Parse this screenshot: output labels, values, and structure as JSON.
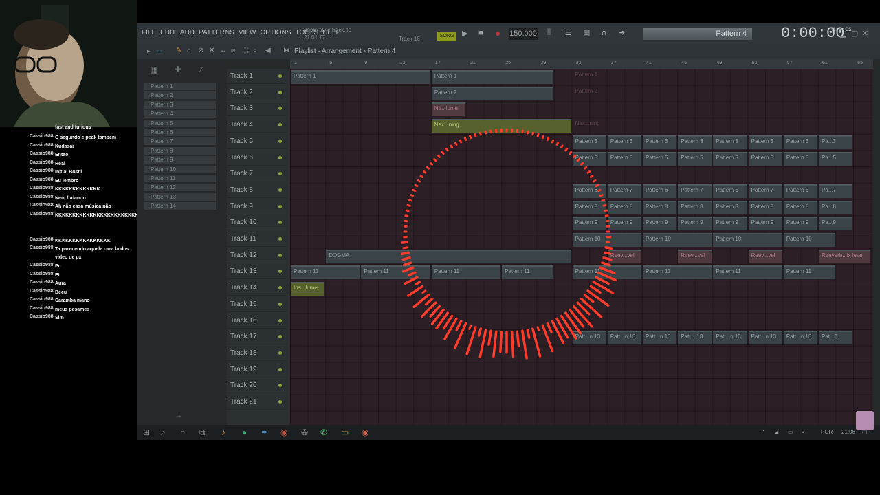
{
  "chat": {
    "first_line": "fast and furious",
    "messages": [
      {
        "user": "Cassio988",
        "text": "O segundo e peak tambem"
      },
      {
        "user": "Cassio988",
        "text": "Kudasai"
      },
      {
        "user": "Cassio988",
        "text": "Entao"
      },
      {
        "user": "Cassio988",
        "text": "Real"
      },
      {
        "user": "Cassio988",
        "text": "Initial Bostil"
      },
      {
        "user": "Cassio988",
        "text": "Eu lembro"
      },
      {
        "user": "Cassio988",
        "text": "KKKKKKKKKKKKK"
      },
      {
        "user": "Cassio988",
        "text": "Nem fudando"
      },
      {
        "user": "Cassio988",
        "text": "Ah não essa música não"
      },
      {
        "user": "Cassio988",
        "text": "KKKKKKKKKKKKKKKKKKKKKKKKKKKKKKKKKKKKKKKKKKKKKKKKKKKLLKKKKKKKKLLL"
      },
      {
        "user": "Cassio988",
        "text": "KKKKKKKKKKKKKKKK"
      },
      {
        "user": "Cassio988",
        "text": "Ta parecendo aquele cara la dos video de px"
      },
      {
        "user": "Cassio988",
        "text": "Pc"
      },
      {
        "user": "Cassio988",
        "text": "Et"
      },
      {
        "user": "Cassio988",
        "text": "Aura"
      },
      {
        "user": "Cassio988",
        "text": "Becu"
      },
      {
        "user": "Cassio988",
        "text": "Caramba mano"
      },
      {
        "user": "Cassio988",
        "text": "meus pesames"
      },
      {
        "user": "Cassio988",
        "text": "Sim"
      }
    ]
  },
  "menu": [
    "FILE",
    "EDIT",
    "ADD",
    "PATTERNS",
    "VIEW",
    "OPTIONS",
    "TOOLS",
    "HELP"
  ],
  "song": {
    "file": "doom style track.flp",
    "time_info": "21:01:77",
    "track_hint": "Track 18"
  },
  "transport": {
    "mode": "SONG",
    "tempo": "150.000",
    "pattern": "Pattern 4",
    "time": "0:00:00",
    "time_unit": "M:S:CS"
  },
  "breadcrumb": "Playlist · Arrangement › Pattern 4",
  "patterns": [
    "Pattern 1",
    "Pattern 2",
    "Pattern 3",
    "Pattern 4",
    "Pattern 5",
    "Pattern 6",
    "Pattern 7",
    "Pattern 8",
    "Pattern 9",
    "Pattern 10",
    "Pattern 11",
    "Pattern 12",
    "Pattern 13",
    "Pattern 14"
  ],
  "ruler": [
    "1",
    "5",
    "9",
    "13",
    "17",
    "21",
    "25",
    "29",
    "33",
    "37",
    "41",
    "45",
    "49",
    "53",
    "57",
    "61",
    "65"
  ],
  "tracks": [
    "Track 1",
    "Track 2",
    "Track 3",
    "Track 4",
    "Track 5",
    "Track 6",
    "Track 7",
    "Track 8",
    "Track 9",
    "Track 10",
    "Track 11",
    "Track 12",
    "Track 13",
    "Track 14",
    "Track 15",
    "Track 16",
    "Track 17",
    "Track 18",
    "Track 19",
    "Track 20",
    "Track 21"
  ],
  "clips": [
    {
      "row": 0,
      "col": 0,
      "len": 8,
      "label": "Pattern 1",
      "kind": "pat"
    },
    {
      "row": 0,
      "col": 8,
      "len": 7,
      "label": "Pattern 1",
      "kind": "pat"
    },
    {
      "row": 0,
      "col": 16,
      "len": 8,
      "label": "Pattern 1",
      "kind": "dim"
    },
    {
      "row": 1,
      "col": 8,
      "len": 7,
      "label": "Pattern 2",
      "kind": "pat"
    },
    {
      "row": 1,
      "col": 16,
      "len": 8,
      "label": "Pattern 2",
      "kind": "dim"
    },
    {
      "row": 2,
      "col": 8,
      "len": 2,
      "label": "Ne...lume",
      "kind": "auto"
    },
    {
      "row": 3,
      "col": 8,
      "len": 8,
      "label": "Nex...ning",
      "kind": "auto-g"
    },
    {
      "row": 3,
      "col": 16,
      "len": 8,
      "label": "Nex...ning",
      "kind": "dim"
    },
    {
      "row": 4,
      "col": 16,
      "len": 2,
      "label": "Pattern 3",
      "kind": "pat"
    },
    {
      "row": 4,
      "col": 18,
      "len": 2,
      "label": "Pattern 3",
      "kind": "pat"
    },
    {
      "row": 4,
      "col": 20,
      "len": 2,
      "label": "Pattern 3",
      "kind": "pat"
    },
    {
      "row": 4,
      "col": 22,
      "len": 2,
      "label": "Pattern 3",
      "kind": "pat"
    },
    {
      "row": 4,
      "col": 24,
      "len": 2,
      "label": "Pattern 3",
      "kind": "pat"
    },
    {
      "row": 4,
      "col": 26,
      "len": 2,
      "label": "Pattern 3",
      "kind": "pat"
    },
    {
      "row": 4,
      "col": 28,
      "len": 2,
      "label": "Pattern 3",
      "kind": "pat"
    },
    {
      "row": 4,
      "col": 30,
      "len": 2,
      "label": "Pa...3",
      "kind": "pat"
    },
    {
      "row": 5,
      "col": 16,
      "len": 2,
      "label": "Pattern 5",
      "kind": "pat"
    },
    {
      "row": 5,
      "col": 18,
      "len": 2,
      "label": "Pattern 5",
      "kind": "pat"
    },
    {
      "row": 5,
      "col": 20,
      "len": 2,
      "label": "Pattern 5",
      "kind": "pat"
    },
    {
      "row": 5,
      "col": 22,
      "len": 2,
      "label": "Pattern 5",
      "kind": "pat"
    },
    {
      "row": 5,
      "col": 24,
      "len": 2,
      "label": "Pattern 5",
      "kind": "pat"
    },
    {
      "row": 5,
      "col": 26,
      "len": 2,
      "label": "Pattern 5",
      "kind": "pat"
    },
    {
      "row": 5,
      "col": 28,
      "len": 2,
      "label": "Pattern 5",
      "kind": "pat"
    },
    {
      "row": 5,
      "col": 30,
      "len": 2,
      "label": "Pa...5",
      "kind": "pat"
    },
    {
      "row": 7,
      "col": 16,
      "len": 2,
      "label": "Pattern 6",
      "kind": "pat"
    },
    {
      "row": 7,
      "col": 18,
      "len": 2,
      "label": "Pattern 7",
      "kind": "pat"
    },
    {
      "row": 7,
      "col": 20,
      "len": 2,
      "label": "Pattern 6",
      "kind": "pat"
    },
    {
      "row": 7,
      "col": 22,
      "len": 2,
      "label": "Pattern 7",
      "kind": "pat"
    },
    {
      "row": 7,
      "col": 24,
      "len": 2,
      "label": "Pattern 6",
      "kind": "pat"
    },
    {
      "row": 7,
      "col": 26,
      "len": 2,
      "label": "Pattern 7",
      "kind": "pat"
    },
    {
      "row": 7,
      "col": 28,
      "len": 2,
      "label": "Pattern 6",
      "kind": "pat"
    },
    {
      "row": 7,
      "col": 30,
      "len": 2,
      "label": "Pa...7",
      "kind": "pat"
    },
    {
      "row": 8,
      "col": 16,
      "len": 2,
      "label": "Pattern 8",
      "kind": "pat"
    },
    {
      "row": 8,
      "col": 18,
      "len": 2,
      "label": "Pattern 8",
      "kind": "pat"
    },
    {
      "row": 8,
      "col": 20,
      "len": 2,
      "label": "Pattern 8",
      "kind": "pat"
    },
    {
      "row": 8,
      "col": 22,
      "len": 2,
      "label": "Pattern 8",
      "kind": "pat"
    },
    {
      "row": 8,
      "col": 24,
      "len": 2,
      "label": "Pattern 8",
      "kind": "pat"
    },
    {
      "row": 8,
      "col": 26,
      "len": 2,
      "label": "Pattern 8",
      "kind": "pat"
    },
    {
      "row": 8,
      "col": 28,
      "len": 2,
      "label": "Pattern 8",
      "kind": "pat"
    },
    {
      "row": 8,
      "col": 30,
      "len": 2,
      "label": "Pa...8",
      "kind": "pat"
    },
    {
      "row": 9,
      "col": 16,
      "len": 2,
      "label": "Pattern 9",
      "kind": "pat"
    },
    {
      "row": 9,
      "col": 18,
      "len": 2,
      "label": "Pattern 9",
      "kind": "pat"
    },
    {
      "row": 9,
      "col": 20,
      "len": 2,
      "label": "Pattern 9",
      "kind": "pat"
    },
    {
      "row": 9,
      "col": 22,
      "len": 2,
      "label": "Pattern 9",
      "kind": "pat"
    },
    {
      "row": 9,
      "col": 24,
      "len": 2,
      "label": "Pattern 9",
      "kind": "pat"
    },
    {
      "row": 9,
      "col": 26,
      "len": 2,
      "label": "Pattern 9",
      "kind": "pat"
    },
    {
      "row": 9,
      "col": 28,
      "len": 2,
      "label": "Pattern 9",
      "kind": "pat"
    },
    {
      "row": 9,
      "col": 30,
      "len": 2,
      "label": "Pa...9",
      "kind": "pat"
    },
    {
      "row": 10,
      "col": 16,
      "len": 4,
      "label": "Pattern 10",
      "kind": "pat"
    },
    {
      "row": 10,
      "col": 20,
      "len": 4,
      "label": "Pattern 10",
      "kind": "pat"
    },
    {
      "row": 10,
      "col": 24,
      "len": 4,
      "label": "Pattern 10",
      "kind": "pat"
    },
    {
      "row": 10,
      "col": 28,
      "len": 3,
      "label": "Pattern 10",
      "kind": "pat"
    },
    {
      "row": 11,
      "col": 2,
      "len": 14,
      "label": "DOGMA",
      "kind": "pat"
    },
    {
      "row": 11,
      "col": 18,
      "len": 2,
      "label": "Reev...vel",
      "kind": "auto"
    },
    {
      "row": 11,
      "col": 22,
      "len": 2,
      "label": "Reev...vel",
      "kind": "auto"
    },
    {
      "row": 11,
      "col": 26,
      "len": 2,
      "label": "Reev...vel",
      "kind": "auto"
    },
    {
      "row": 11,
      "col": 30,
      "len": 3,
      "label": "Reeverb...ix level",
      "kind": "auto"
    },
    {
      "row": 12,
      "col": 0,
      "len": 4,
      "label": "Pattern 11",
      "kind": "pat"
    },
    {
      "row": 12,
      "col": 4,
      "len": 4,
      "label": "Pattern 11",
      "kind": "pat"
    },
    {
      "row": 12,
      "col": 8,
      "len": 4,
      "label": "Pattern 11",
      "kind": "pat"
    },
    {
      "row": 12,
      "col": 12,
      "len": 3,
      "label": "Pattern 11",
      "kind": "pat"
    },
    {
      "row": 12,
      "col": 16,
      "len": 4,
      "label": "Pattern 11",
      "kind": "pat"
    },
    {
      "row": 12,
      "col": 20,
      "len": 4,
      "label": "Pattern 11",
      "kind": "pat"
    },
    {
      "row": 12,
      "col": 24,
      "len": 4,
      "label": "Pattern 11",
      "kind": "pat"
    },
    {
      "row": 12,
      "col": 28,
      "len": 3,
      "label": "Pattern 11",
      "kind": "pat"
    },
    {
      "row": 13,
      "col": 0,
      "len": 2,
      "label": "Ins...lume",
      "kind": "auto-g"
    },
    {
      "row": 16,
      "col": 16,
      "len": 2,
      "label": "Patt...n 13",
      "kind": "pat"
    },
    {
      "row": 16,
      "col": 18,
      "len": 2,
      "label": "Patt...n 13",
      "kind": "pat"
    },
    {
      "row": 16,
      "col": 20,
      "len": 2,
      "label": "Patt...n 13",
      "kind": "pat"
    },
    {
      "row": 16,
      "col": 22,
      "len": 2,
      "label": "Patt... 13",
      "kind": "pat"
    },
    {
      "row": 16,
      "col": 24,
      "len": 2,
      "label": "Patt...n 13",
      "kind": "pat"
    },
    {
      "row": 16,
      "col": 26,
      "len": 2,
      "label": "Patt...n 13",
      "kind": "pat"
    },
    {
      "row": 16,
      "col": 28,
      "len": 2,
      "label": "Patt...n 13",
      "kind": "pat"
    },
    {
      "row": 16,
      "col": 30,
      "len": 2,
      "label": "Pat...3",
      "kind": "pat"
    }
  ],
  "tray": {
    "lang": "POR",
    "clock": "21:06"
  }
}
